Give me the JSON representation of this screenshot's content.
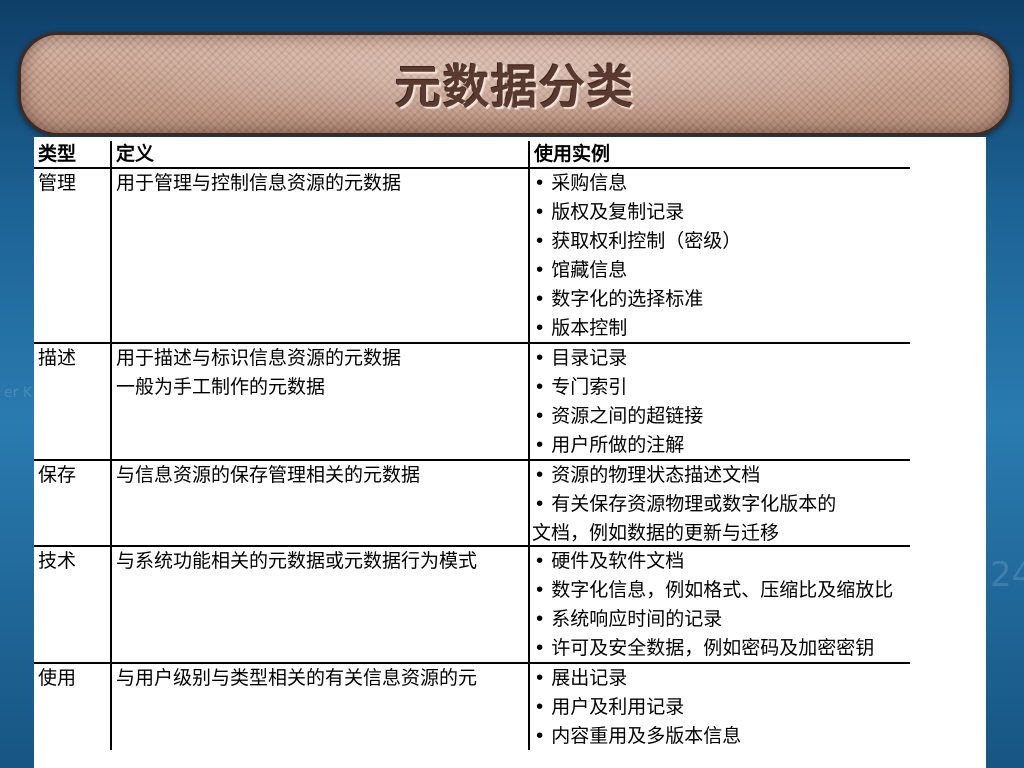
{
  "slide": {
    "title": "元数据分类"
  },
  "table": {
    "headers": [
      "类型",
      "定义",
      "使用实例"
    ],
    "rows": [
      {
        "type": "管理",
        "definition": [
          "用于管理与控制信息资源的元数据"
        ],
        "examples": [
          "采购信息",
          "版权及复制记录",
          "获取权利控制（密级）",
          "馆藏信息",
          "数字化的选择标准",
          "版本控制"
        ]
      },
      {
        "type": "描述",
        "definition": [
          "用于描述与标识信息资源的元数据",
          "一般为手工制作的元数据"
        ],
        "examples": [
          "目录记录",
          "专门索引",
          "资源之间的超链接",
          "用户所做的注解"
        ]
      },
      {
        "type": "保存",
        "definition": [
          "与信息资源的保存管理相关的元数据"
        ],
        "examples": [
          "资源的物理状态描述文档",
          "有关保存资源物理或数字化版本的"
        ],
        "examples_continuation": "文档，例如数据的更新与迁移"
      },
      {
        "type": "技术",
        "definition": [
          "与系统功能相关的元数据或元数据行为模式"
        ],
        "examples": [
          "硬件及软件文档",
          "数字化信息，例如格式、压缩比及缩放比",
          "系统响应时间的记录",
          "许可及安全数据，例如密码及加密密钥"
        ]
      },
      {
        "type": "使用",
        "definition": [
          "与用户级别与类型相关的有关信息资源的元"
        ],
        "examples": [
          "展出记录",
          "用户及利用记录",
          "内容重用及多版本信息"
        ]
      }
    ]
  }
}
